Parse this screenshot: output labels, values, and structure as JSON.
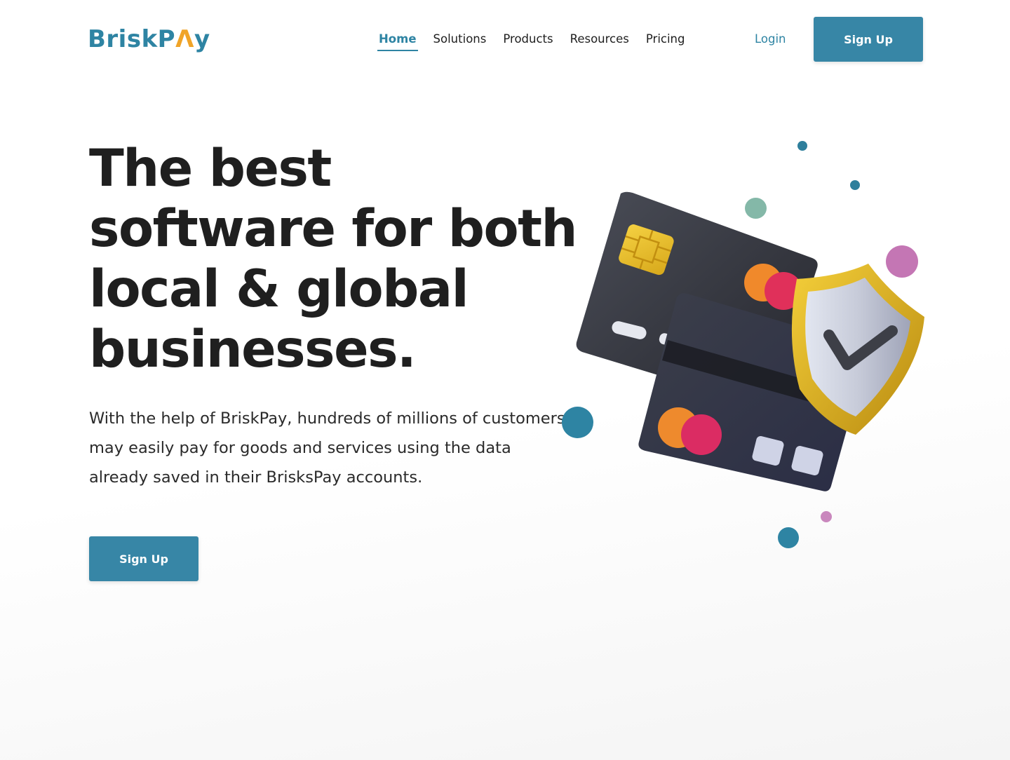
{
  "brand": {
    "name_prefix": "BriskP",
    "name_accent": "Λ",
    "name_suffix": "y"
  },
  "nav": {
    "items": [
      {
        "label": "Home",
        "active": true
      },
      {
        "label": "Solutions",
        "active": false
      },
      {
        "label": "Products",
        "active": false
      },
      {
        "label": "Resources",
        "active": false
      },
      {
        "label": "Pricing",
        "active": false
      }
    ],
    "login_label": "Login",
    "signup_label": "Sign Up"
  },
  "hero": {
    "headline": "The best software for both local & global businesses.",
    "subtext": "With the help of BriskPay, hundreds of millions of customers may easily pay for goods and services using the data already saved in their BrisksPay accounts.",
    "cta_label": "Sign Up"
  },
  "illustration": {
    "icons": [
      "credit-card-icon",
      "shield-check-icon"
    ]
  },
  "colors": {
    "primary": "#3786a6",
    "accent": "#f0a428",
    "text": "#1f1f1f"
  }
}
